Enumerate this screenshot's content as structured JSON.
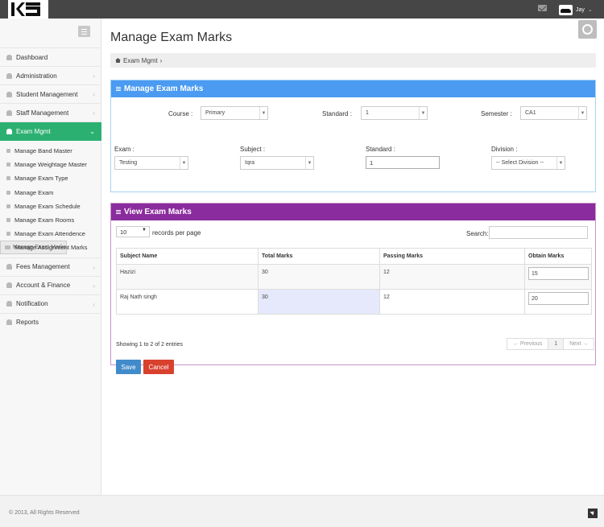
{
  "header": {
    "user_name": "Jay"
  },
  "sidebar": {
    "items": [
      {
        "label": "Dashboard"
      },
      {
        "label": "Administration"
      },
      {
        "label": "Student Management"
      },
      {
        "label": "Staff Management"
      },
      {
        "label": "Exam Mgmt"
      },
      {
        "label": "Fees Management"
      },
      {
        "label": "Account & Finance"
      },
      {
        "label": "Notification"
      },
      {
        "label": "Reports"
      }
    ],
    "subitems": [
      {
        "label": "Manage Band Master"
      },
      {
        "label": "Manage Weightage Master"
      },
      {
        "label": "Manage Exam Type"
      },
      {
        "label": "Manage Exam"
      },
      {
        "label": "Manage Exam Schedule"
      },
      {
        "label": "Manage Exam Rooms"
      },
      {
        "label": "Manage Exam Attendence"
      },
      {
        "label": "Manage Exam Marks"
      },
      {
        "label": "Manage Assignment Marks"
      }
    ]
  },
  "page": {
    "title": "Manage Exam Marks",
    "breadcrumb": "Exam Mgmt"
  },
  "filter_panel": {
    "title": "Manage Exam Marks",
    "course_label": "Course :",
    "course_value": "Primary",
    "standard_label": "Standard :",
    "standard_value": "1",
    "semester_label": "Semester :",
    "semester_value": "CA1",
    "exam_label": "Exam :",
    "exam_value": "Testing",
    "subject_label": "Subject :",
    "subject_value": "Iqra",
    "standard2_label": "Standard :",
    "standard2_value": "1",
    "division_label": "Division :",
    "division_value": "-- Select Division --"
  },
  "marks_panel": {
    "title": "View Exam Marks",
    "records_per_page": "10",
    "records_label": "records per page",
    "search_label": "Search:",
    "columns": [
      "Subject Name",
      "Total Marks",
      "Passing Marks",
      "Obtain Marks"
    ],
    "rows": [
      {
        "subject": "Hazizi",
        "total": "30",
        "passing": "12",
        "obtain": "15"
      },
      {
        "subject": "Raj Nath singh",
        "total": "30",
        "passing": "12",
        "obtain": "20"
      }
    ],
    "showing": "Showing 1 to 2 of 2 entries",
    "prev": "← Previous",
    "page": "1",
    "next": "Next →",
    "save": "Save",
    "cancel": "Cancel"
  },
  "footer": {
    "copyright": "© 2013, All Rights Reserved"
  },
  "colors": {
    "topbar": "#464646",
    "active_menu": "#2cb071",
    "panel1": "#4a9bf1",
    "panel2": "#8b2c9e",
    "save": "#428bca",
    "cancel": "#d9412f"
  }
}
